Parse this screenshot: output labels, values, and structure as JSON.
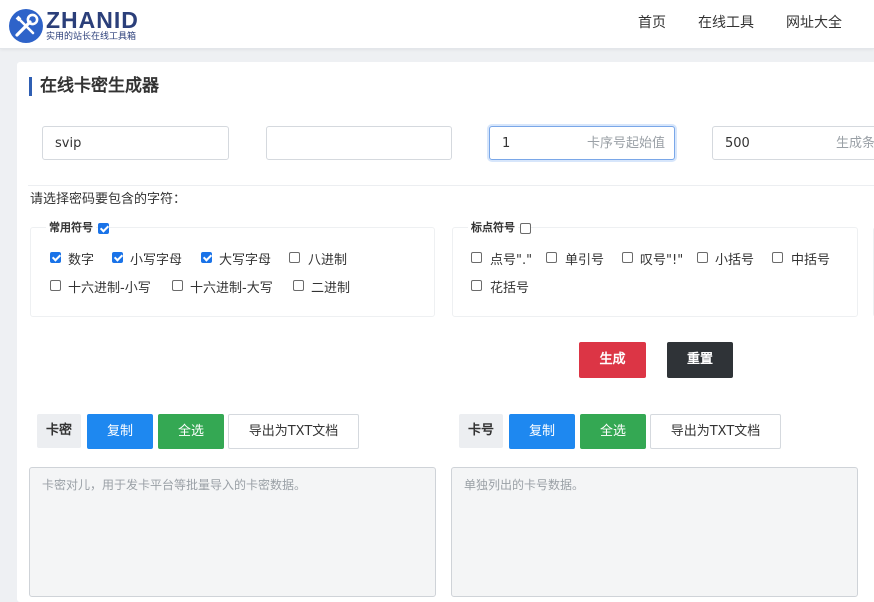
{
  "header": {
    "logo_text": "ZHANID",
    "logo_subtitle": "实用的站长在线工具箱",
    "nav": {
      "home": "首页",
      "tools": "在线工具",
      "sites": "网址大全"
    }
  },
  "page": {
    "title": "在线卡密生成器"
  },
  "fields": {
    "prefix_value": "svip",
    "blank_value": "",
    "start_value": "1",
    "start_hint": "卡序号起始值",
    "count_value": "500",
    "count_hint": "生成条"
  },
  "charset": {
    "label": "请选择密码要包含的字符：",
    "common": {
      "legend": "常用符号",
      "legend_checked": true,
      "options": [
        {
          "label": "数字",
          "checked": true
        },
        {
          "label": "小写字母",
          "checked": true
        },
        {
          "label": "大写字母",
          "checked": true
        },
        {
          "label": "八进制",
          "checked": false
        },
        {
          "label": "十六进制-小写",
          "checked": false
        },
        {
          "label": "十六进制-大写",
          "checked": false
        },
        {
          "label": "二进制",
          "checked": false
        }
      ]
    },
    "punct": {
      "legend": "标点符号",
      "legend_checked": false,
      "options": [
        {
          "label": "点号\".\"",
          "checked": false
        },
        {
          "label": "单引号",
          "checked": false
        },
        {
          "label": "叹号\"!\"",
          "checked": false
        },
        {
          "label": "小括号",
          "checked": false
        },
        {
          "label": "中括号",
          "checked": false
        },
        {
          "label": "花括号",
          "checked": false
        }
      ]
    }
  },
  "actions": {
    "generate": "生成",
    "reset": "重置"
  },
  "outputs": {
    "cards": {
      "tag": "卡密",
      "copy": "复制",
      "select_all": "全选",
      "export": "导出为TXT文档",
      "placeholder": "卡密对儿，用于发卡平台等批量导入的卡密数据。"
    },
    "numbers": {
      "tag": "卡号",
      "copy": "复制",
      "select_all": "全选",
      "export": "导出为TXT文档",
      "placeholder": "单独列出的卡号数据。"
    }
  },
  "colors": {
    "accent": "#1e88f0",
    "danger": "#dc3545",
    "success": "#34a853",
    "dark": "#2f3337",
    "brand": "#2b3f7a"
  }
}
